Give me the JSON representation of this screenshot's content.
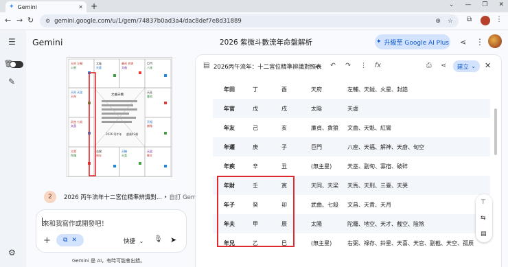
{
  "browser": {
    "tab_title": "Gemini",
    "url": "gemini.google.com/u/1/gem/74837b0ad3a4/dac8def7e8d31889"
  },
  "header": {
    "brand": "Gemini",
    "chat_title": "2026 紫微斗數流年命盤解析",
    "upgrade_label": "升級至 Google AI Plus"
  },
  "chart_thumbnail": {
    "center_title": "文曲天機",
    "center_note": "2026 丙午年",
    "center_note2": "虛歲43歲"
  },
  "response_item": {
    "number": "2",
    "title": "2026 丙午流年十二宮位精準辨識對...",
    "source": "• 自訂 Gem"
  },
  "composer": {
    "placeholder": "來和我寫作或開發吧！",
    "mode_label": "快捷",
    "footnote": "Gemini 是 AI，有時可能會出錯。"
  },
  "doc_panel": {
    "title": "2026丙午流年：十二宮位精準辨識對照表",
    "build_label": "建立",
    "rows": [
      {
        "palace": "年田",
        "stem": "丁",
        "branch": "酉",
        "main": "天府",
        "aux": "左輔、天鉞、火星、封誥"
      },
      {
        "palace": "年官",
        "stem": "戊",
        "branch": "戌",
        "main": "太陰",
        "aux": "天虛"
      },
      {
        "palace": "年友",
        "stem": "己",
        "branch": "亥",
        "main": "廉貞、貪狼",
        "aux": "文曲、天魁、紅鸞"
      },
      {
        "palace": "年遷",
        "stem": "庚",
        "branch": "子",
        "main": "巨門",
        "aux": "八座、天福、解神、天廚、旬空"
      },
      {
        "palace": "年疾",
        "stem": "辛",
        "branch": "丑",
        "main": "(無主星)",
        "aux": "天巫、副旬、寡宿、破碎"
      },
      {
        "palace": "年財",
        "stem": "壬",
        "branch": "寅",
        "main": "天同、天梁",
        "aux": "天馬、天刑、三臺、天哭"
      },
      {
        "palace": "年子",
        "stem": "癸",
        "branch": "卯",
        "main": "武曲、七殺",
        "aux": "文昌、天貴、天月"
      },
      {
        "palace": "年夫",
        "stem": "甲",
        "branch": "辰",
        "main": "太陽",
        "aux": "陀羅、地空、天才、截空、陰煞"
      },
      {
        "palace": "年兄",
        "stem": "乙",
        "branch": "巳",
        "main": "(無主星)",
        "aux": "右弼、祿存、鈴星、天喜、天官、副截、天空、孤辰"
      }
    ]
  }
}
